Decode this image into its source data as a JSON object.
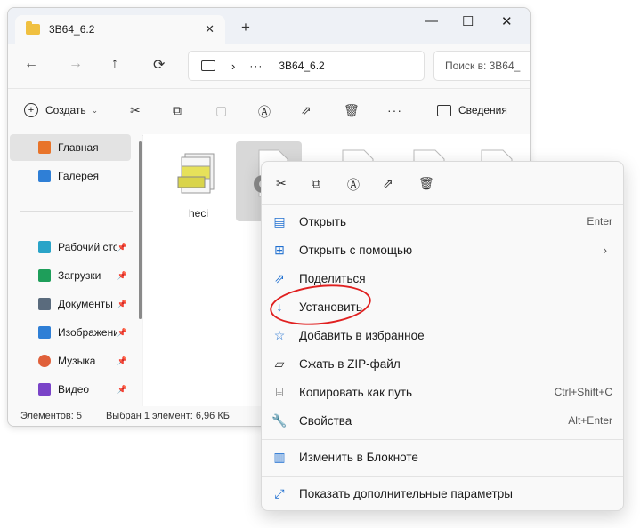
{
  "window": {
    "tab_title": "3B64_6.2",
    "close_tab": "✕",
    "new_tab": "+",
    "minimize": "—",
    "maximize": "☐",
    "close": "✕"
  },
  "nav": {
    "back": "←",
    "forward": "→",
    "up": "↑",
    "refresh": "⟳",
    "separator": "›",
    "more_path": "···",
    "path": "3B64_6.2",
    "search_placeholder": "Поиск в: 3B64_"
  },
  "toolbar": {
    "create": "Создать",
    "more": "···",
    "details": "Сведения"
  },
  "sidebar": {
    "items": [
      {
        "label": "Главная",
        "color": "#e8742a",
        "pinned": false
      },
      {
        "label": "Галерея",
        "color": "#2f7fd6",
        "pinned": false
      },
      {
        "label": "Рабочий сто",
        "color": "#2aa4c8",
        "pinned": true
      },
      {
        "label": "Загрузки",
        "color": "#1e9e5a",
        "pinned": true
      },
      {
        "label": "Документы",
        "color": "#5a6b7d",
        "pinned": true
      },
      {
        "label": "Изображени",
        "color": "#2f7fd6",
        "pinned": true
      },
      {
        "label": "Музыка",
        "color": "#e0603a",
        "pinned": true
      },
      {
        "label": "Видео",
        "color": "#7a44c8",
        "pinned": true
      }
    ]
  },
  "files": [
    {
      "name": "heci"
    }
  ],
  "status": {
    "count": "Элементов: 5",
    "selected": "Выбран 1 элемент: 6,96 КБ"
  },
  "context_menu": {
    "items": [
      {
        "label": "Открыть",
        "shortcut": "Enter",
        "icon": "open-icon"
      },
      {
        "label": "Открыть с помощью",
        "shortcut": "›",
        "icon": "open-with-icon"
      },
      {
        "label": "Поделиться",
        "shortcut": "",
        "icon": "share-icon"
      },
      {
        "label": "Установить",
        "shortcut": "",
        "icon": "install-icon"
      },
      {
        "label": "Добавить в избранное",
        "shortcut": "",
        "icon": "star-icon"
      },
      {
        "label": "Сжать в ZIP-файл",
        "shortcut": "",
        "icon": "zip-icon"
      },
      {
        "label": "Копировать как путь",
        "shortcut": "Ctrl+Shift+C",
        "icon": "copy-path-icon"
      },
      {
        "label": "Свойства",
        "shortcut": "Alt+Enter",
        "icon": "wrench-icon"
      },
      {
        "label": "Изменить в Блокноте",
        "shortcut": "",
        "icon": "notepad-icon"
      },
      {
        "label": "Показать дополнительные параметры",
        "shortcut": "",
        "icon": "more-options-icon"
      }
    ]
  },
  "annotation_color": "#e02020"
}
